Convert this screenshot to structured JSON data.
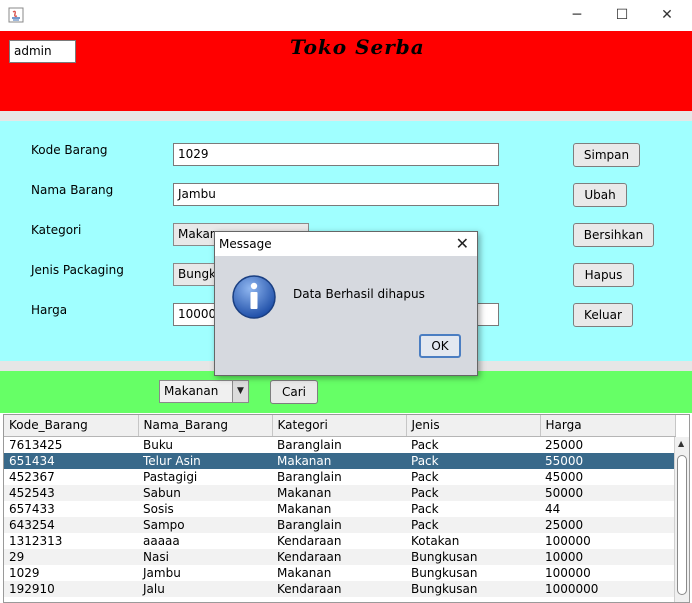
{
  "window": {
    "minimize_glyph": "─",
    "maximize_glyph": "☐",
    "close_glyph": "✕"
  },
  "header": {
    "user": "admin",
    "title": "Toko Serba",
    "bg_color": "#ff0000"
  },
  "form": {
    "bg_color": "#a0ffff",
    "kode_label": "Kode Barang",
    "kode_value": "1029",
    "nama_label": "Nama Barang",
    "nama_value": "Jambu",
    "kategori_label": "Kategori",
    "kategori_value": "Makanan",
    "jenis_label": "Jenis Packaging",
    "jenis_value": "Bungkusan",
    "harga_label": "Harga",
    "harga_value": "100000"
  },
  "buttons": {
    "simpan": "Simpan",
    "ubah": "Ubah",
    "bersihkan": "Bersihkan",
    "hapus": "Hapus",
    "keluar": "Keluar"
  },
  "search": {
    "bg_color": "#66ff66",
    "category": "Makanan",
    "cari": "Cari"
  },
  "table": {
    "columns": [
      "Kode_Barang",
      "Nama_Barang",
      "Kategori",
      "Jenis",
      "Harga"
    ],
    "selected_color": "#39698a",
    "rows": [
      [
        "7613425",
        "Buku",
        "Baranglain",
        "Pack",
        "25000"
      ],
      [
        "651434",
        "Telur Asin",
        "Makanan",
        "Pack",
        "55000"
      ],
      [
        "452367",
        "Pastagigi",
        "Baranglain",
        "Pack",
        "45000"
      ],
      [
        "452543",
        "Sabun",
        "Makanan",
        "Pack",
        "50000"
      ],
      [
        "657433",
        "Sosis",
        "Makanan",
        "Pack",
        "44"
      ],
      [
        "643254",
        "Sampo",
        "Baranglain",
        "Pack",
        "25000"
      ],
      [
        "1312313",
        "aaaaa",
        "Kendaraan",
        "Kotakan",
        "100000"
      ],
      [
        "29",
        "Nasi",
        "Kendaraan",
        "Bungkusan",
        "10000"
      ],
      [
        "1029",
        "Jambu",
        "Makanan",
        "Bungkusan",
        "100000"
      ],
      [
        "192910",
        "Jalu",
        "Kendaraan",
        "Bungkusan",
        "1000000"
      ]
    ]
  },
  "dialog": {
    "title": "Message",
    "message": "Data Berhasil dihapus",
    "ok": "OK",
    "close_glyph": "✕",
    "icon": "information-icon"
  }
}
